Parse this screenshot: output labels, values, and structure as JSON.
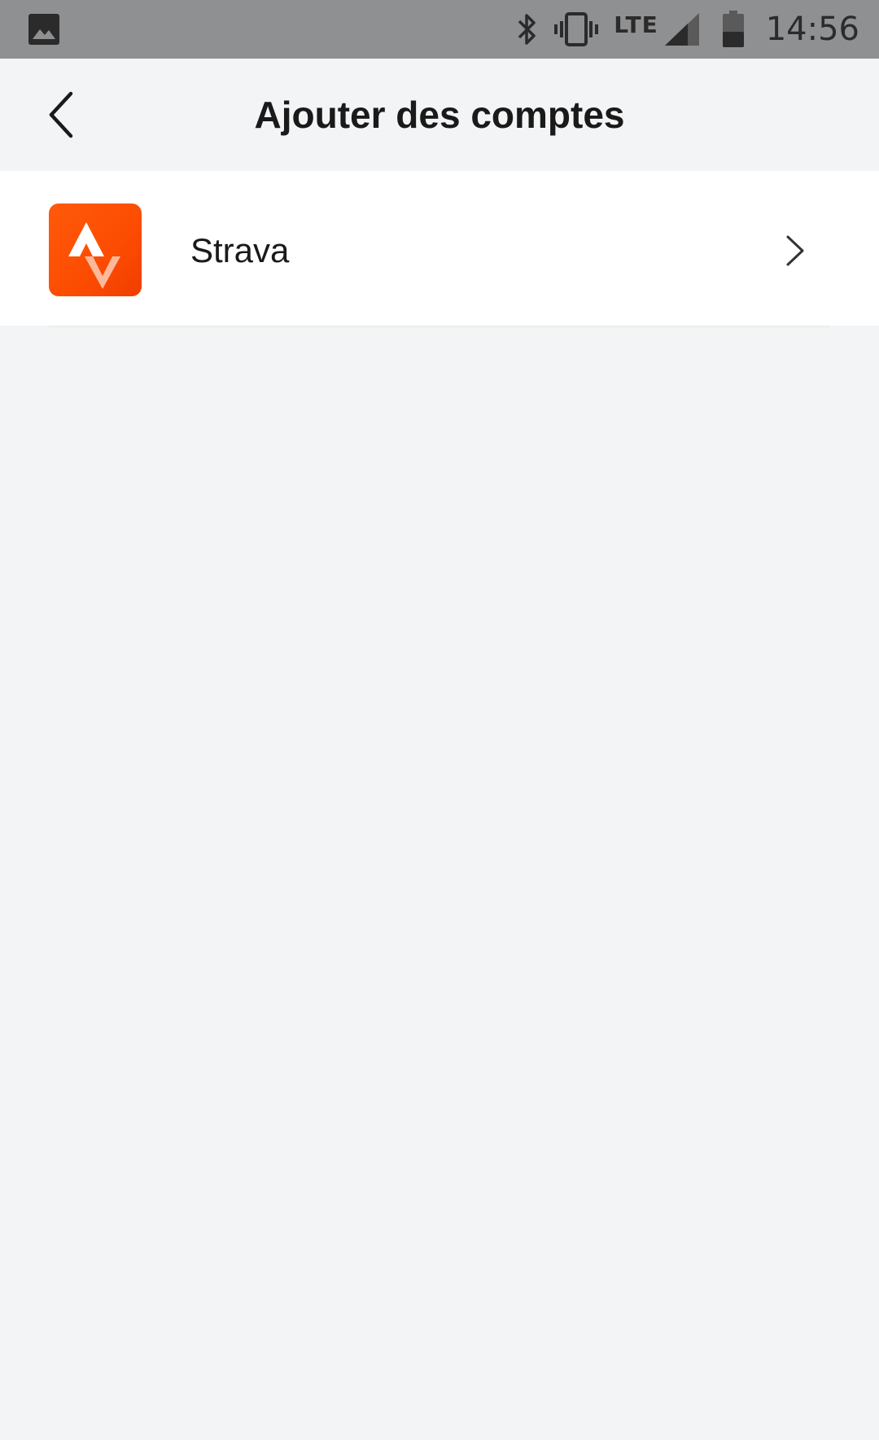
{
  "status_bar": {
    "left_icon": "image-icon",
    "icons": [
      "bluetooth-icon",
      "vibrate-icon",
      "signal-icon",
      "battery-icon"
    ],
    "network": "LTE",
    "time": "14:56",
    "background": "#8f9091"
  },
  "header": {
    "back_icon": "chevron-left-icon",
    "title": "Ajouter des comptes"
  },
  "accounts": [
    {
      "name": "Strava",
      "logo_icon": "strava-logo-icon",
      "brand_color": "#fc4c02",
      "trailing_icon": "chevron-right-icon"
    }
  ],
  "colors": {
    "page_background": "#f3f4f6",
    "list_background": "#ffffff",
    "text": "#1a1a1a"
  }
}
